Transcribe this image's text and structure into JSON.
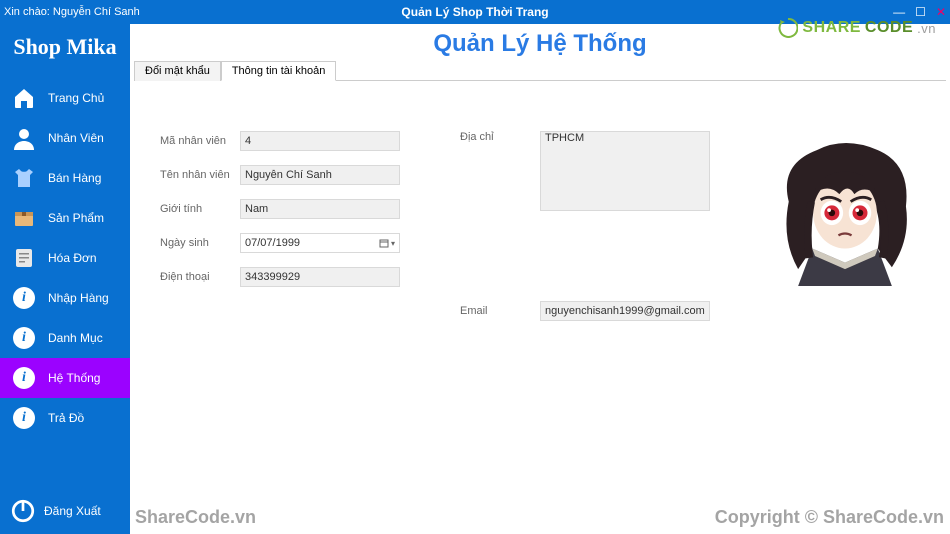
{
  "titlebar": {
    "greeting": "Xin chào: Nguyễn Chí Sanh",
    "title": "Quản Lý Shop Thời Trang"
  },
  "sidebar": {
    "brand": "Shop Mika",
    "items": [
      {
        "label": "Trang Chủ",
        "icon": "home"
      },
      {
        "label": "Nhân Viên",
        "icon": "user"
      },
      {
        "label": "Bán Hàng",
        "icon": "shirt"
      },
      {
        "label": "Sản Phẩm",
        "icon": "box"
      },
      {
        "label": "Hóa Đơn",
        "icon": "invoice"
      },
      {
        "label": "Nhập Hàng",
        "icon": "info"
      },
      {
        "label": "Danh Mục",
        "icon": "info"
      },
      {
        "label": "Hệ Thống",
        "icon": "info",
        "active": true
      },
      {
        "label": "Trả Đồ",
        "icon": "info"
      }
    ],
    "logout": "Đăng Xuất"
  },
  "main": {
    "pageTitle": "Quản Lý Hệ Thống",
    "tabs": [
      {
        "label": "Đổi mật khẩu"
      },
      {
        "label": "Thông tin tài khoản",
        "active": true
      }
    ],
    "form": {
      "idLabel": "Mã nhân viên",
      "idVal": "4",
      "nameLabel": "Tên nhân viên",
      "nameVal": "Nguyễn Chí Sanh",
      "genderLabel": "Giới tính",
      "genderVal": "Nam",
      "dobLabel": "Ngày sinh",
      "dobVal": "07/07/1999",
      "phoneLabel": "Điện thoại",
      "phoneVal": "343399929",
      "addrLabel": "Địa chỉ",
      "addrVal": "TPHCM",
      "emailLabel": "Email",
      "emailVal": "nguyenchisanh1999@gmail.com"
    }
  },
  "watermark": {
    "share": "SHARE",
    "code": "CODE",
    "vn": ".vn",
    "footerLeft": "ShareCode.vn",
    "footerRight": "Copyright © ShareCode.vn"
  }
}
